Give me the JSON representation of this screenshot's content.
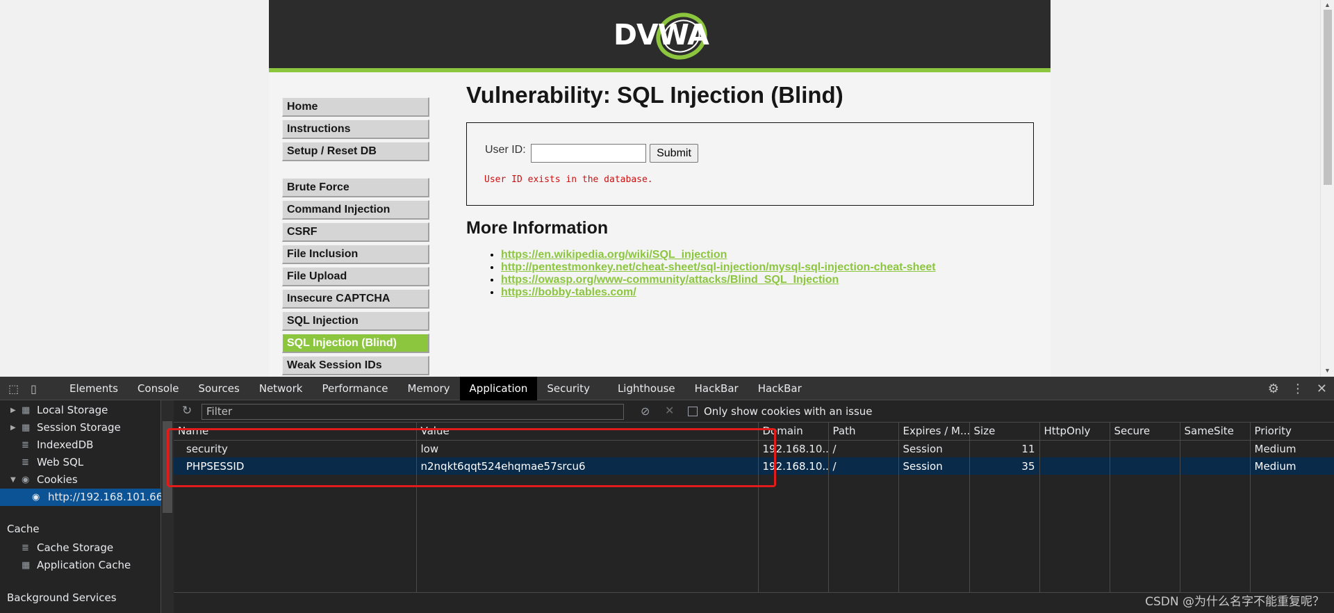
{
  "dvwa": {
    "logo_text": "DVWA",
    "menu_group1": [
      "Home",
      "Instructions",
      "Setup / Reset DB"
    ],
    "menu_group2": [
      "Brute Force",
      "Command Injection",
      "CSRF",
      "File Inclusion",
      "File Upload",
      "Insecure CAPTCHA",
      "SQL Injection",
      "SQL Injection (Blind)",
      "Weak Session IDs"
    ],
    "active_menu": "SQL Injection (Blind)",
    "title": "Vulnerability: SQL Injection (Blind)",
    "form": {
      "label": "User ID:",
      "input_value": "",
      "submit_label": "Submit"
    },
    "result_message": "User ID exists in the database.",
    "more_info_title": "More Information",
    "links": [
      "https://en.wikipedia.org/wiki/SQL_injection",
      "http://pentestmonkey.net/cheat-sheet/sql-injection/mysql-sql-injection-cheat-sheet",
      "https://owasp.org/www-community/attacks/Blind_SQL_Injection",
      "https://bobby-tables.com/"
    ]
  },
  "devtools": {
    "tabs": [
      "Elements",
      "Console",
      "Sources",
      "Network",
      "Performance",
      "Memory",
      "Application",
      "Security",
      "Lighthouse",
      "HackBar",
      "HackBar"
    ],
    "active_tab": "Application",
    "sidebar": {
      "storage_items": [
        "Local Storage",
        "Session Storage",
        "IndexedDB",
        "Web SQL",
        "Cookies"
      ],
      "cookie_origin": "http://192.168.101.66",
      "cache_header": "Cache",
      "cache_items": [
        "Cache Storage",
        "Application Cache"
      ],
      "background_header": "Background Services"
    },
    "filter_placeholder": "Filter",
    "only_issue_label": "Only show cookies with an issue",
    "table": {
      "columns": [
        "Name",
        "Value",
        "Domain",
        "Path",
        "Expires / M...",
        "Size",
        "HttpOnly",
        "Secure",
        "SameSite",
        "Priority"
      ],
      "rows": [
        [
          "security",
          "low",
          "192.168.10...",
          "/",
          "Session",
          "11",
          "",
          "",
          "",
          "Medium"
        ],
        [
          "PHPSESSID",
          "n2nqkt6qqt524ehqmae57srcu6",
          "192.168.10...",
          "/",
          "Session",
          "35",
          "",
          "",
          "",
          "Medium"
        ]
      ],
      "selected_row": 1
    }
  },
  "watermark": "CSDN @为什么名字不能重复呢？",
  "colors": {
    "dvwa_green": "#8cc63f",
    "devtools_bg": "#242424",
    "highlight": "#e21b1b",
    "selected_row": "#0a2a4a"
  }
}
